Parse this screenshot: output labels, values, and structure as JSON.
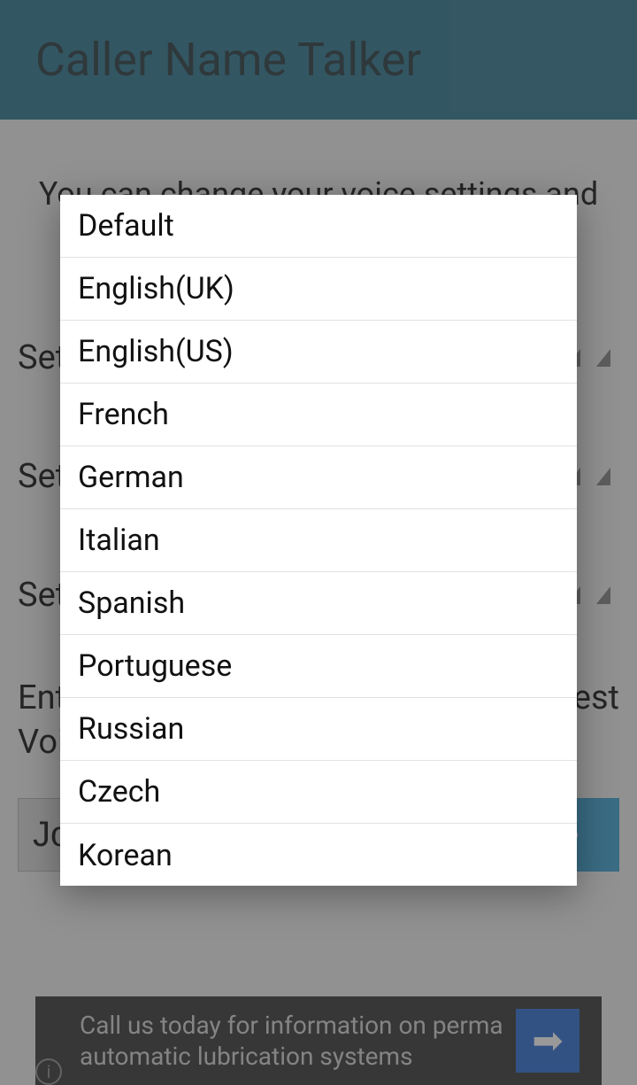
{
  "header": {
    "title": "Caller Name Talker"
  },
  "intro": "You can change your voice settings and test",
  "settings_rows": [
    {
      "label": "Set"
    },
    {
      "label": "Set"
    },
    {
      "label": "Set"
    }
  ],
  "enter_text_label_line1": "Ente",
  "enter_text_label_line1_cut": "est",
  "voice_label_partial": "Voi",
  "input_value": "Jo",
  "test_button_label_partial": "e",
  "language_options": [
    "Default",
    "English(UK)",
    "English(US)",
    "French",
    "German",
    "Italian",
    "Spanish",
    "Portuguese",
    "Russian",
    "Czech",
    "Korean"
  ],
  "ad": {
    "text": "Call us today for information on perma automatic lubrication systems",
    "arrow_glyph": "➡",
    "info_glyph": "i"
  }
}
